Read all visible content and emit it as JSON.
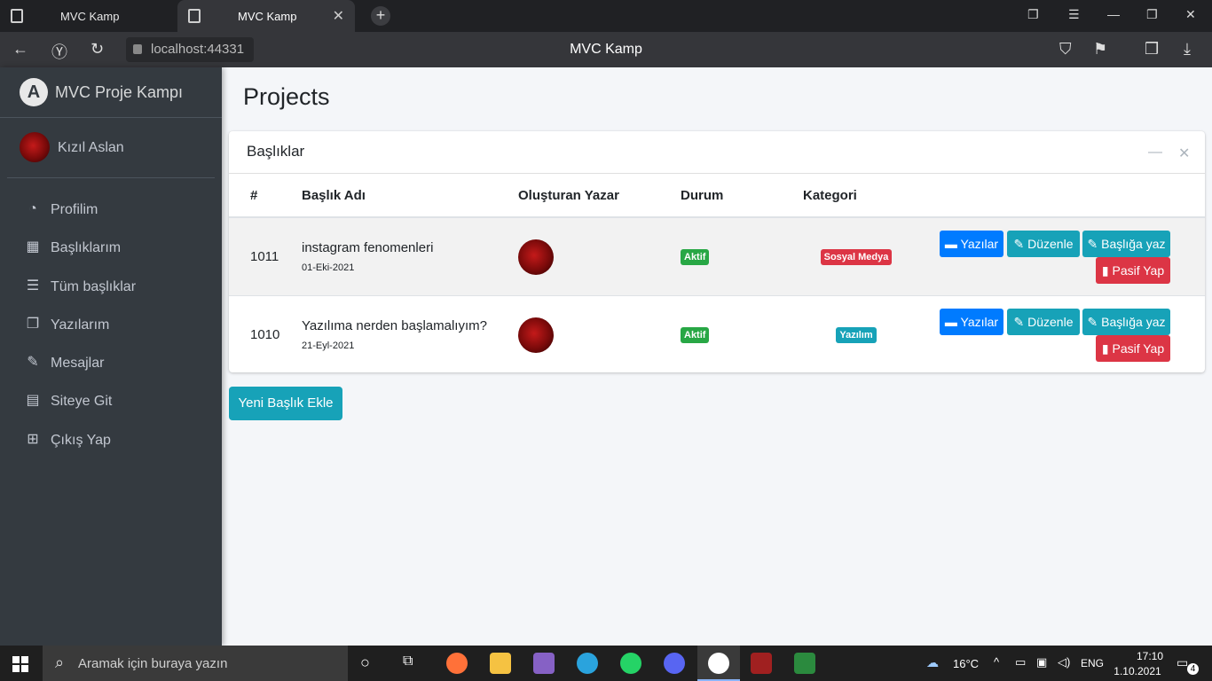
{
  "browser": {
    "tabs": [
      {
        "title": "MVC Kamp",
        "active": false
      },
      {
        "title": "MVC Kamp",
        "active": true
      }
    ],
    "url": "localhost:44331",
    "window_title": "MVC Kamp"
  },
  "sidebar": {
    "brand": "MVC Proje Kampı",
    "user_name": "Kızıl Aslan",
    "items": [
      {
        "label": "Profilim",
        "icon": "dashboard-icon"
      },
      {
        "label": "Başlıklarım",
        "icon": "grid-icon"
      },
      {
        "label": "Tüm başlıklar",
        "icon": "list-icon"
      },
      {
        "label": "Yazılarım",
        "icon": "copy-icon"
      },
      {
        "label": "Mesajlar",
        "icon": "edit-icon"
      },
      {
        "label": "Siteye Git",
        "icon": "book-icon"
      },
      {
        "label": "Çıkış Yap",
        "icon": "plus-square-icon"
      }
    ]
  },
  "main": {
    "page_title": "Projects",
    "card_title": "Başlıklar",
    "columns": [
      "#",
      "Başlık Adı",
      "Oluşturan Yazar",
      "Durum",
      "Kategori"
    ],
    "rows": [
      {
        "id": "1011",
        "title": "instagram fenomenleri",
        "date": "01-Eki-2021",
        "status": "Aktif",
        "category": "Sosyal Medya",
        "category_color": "#dc3545"
      },
      {
        "id": "1010",
        "title": "Yazılıma nerden başlamalıyım?",
        "date": "21-Eyl-2021",
        "status": "Aktif",
        "category": "Yazılım",
        "category_color": "#17a2b8"
      }
    ],
    "row_actions": {
      "posts": "Yazılar",
      "edit": "Düzenle",
      "write": "Başlığa yaz",
      "passive": "Pasif Yap"
    },
    "add_button": "Yeni Başlık Ekle"
  },
  "taskbar": {
    "search_placeholder": "Aramak için buraya yazın",
    "weather": "16°C",
    "language": "ENG",
    "time": "17:10",
    "date": "1.10.2021",
    "notification_count": "4"
  },
  "colors": {
    "sidebar_bg": "#343a40",
    "primary": "#007bff",
    "info": "#17a2b8",
    "danger": "#dc3545",
    "success": "#28a745"
  }
}
